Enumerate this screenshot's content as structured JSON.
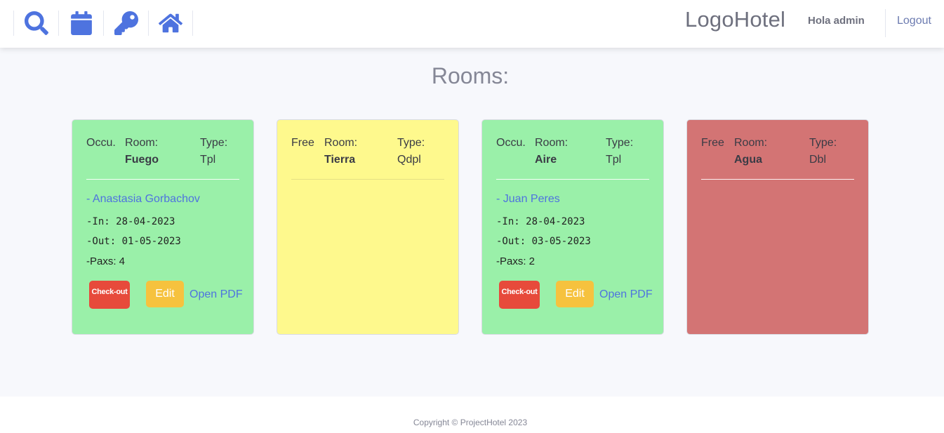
{
  "header": {
    "nav": [
      {
        "name": "search-icon"
      },
      {
        "name": "calendar-icon"
      },
      {
        "name": "key-icon"
      },
      {
        "name": "home-icon"
      }
    ],
    "logo": "LogoHotel",
    "greeting": "Hola admin",
    "logout": "Logout"
  },
  "main": {
    "title": "Rooms:",
    "rooms": [
      {
        "status": "Occu.",
        "room_label": "Room:",
        "room": "Fuego",
        "type_label": "Type:",
        "type": "Tpl",
        "color": "#9af0a9",
        "guest": "- Anastasia Gorbachov",
        "in": "-In: 28-04-2023",
        "out": "-Out: 01-05-2023",
        "paxs": "-Paxs: 4",
        "checkout": "Check-out",
        "edit": "Edit",
        "pdf": "Open PDF"
      },
      {
        "status": "Free",
        "room_label": "Room:",
        "room": "Tierra",
        "type_label": "Type:",
        "type": "Qdpl",
        "color": "#fef98d"
      },
      {
        "status": "Occu.",
        "room_label": "Room:",
        "room": "Aire",
        "type_label": "Type:",
        "type": "Tpl",
        "color": "#9af0a9",
        "guest": "- Juan Peres",
        "in": "-In: 28-04-2023",
        "out": "-Out: 03-05-2023",
        "paxs": "-Paxs: 2",
        "checkout": "Check-out",
        "edit": "Edit",
        "pdf": "Open PDF"
      },
      {
        "status": "Free",
        "room_label": "Room:",
        "room": "Agua",
        "type_label": "Type:",
        "type": "Dbl",
        "color": "#d37474"
      }
    ]
  },
  "footer": {
    "copyright": "Copyright © ProjectHotel 2023"
  }
}
